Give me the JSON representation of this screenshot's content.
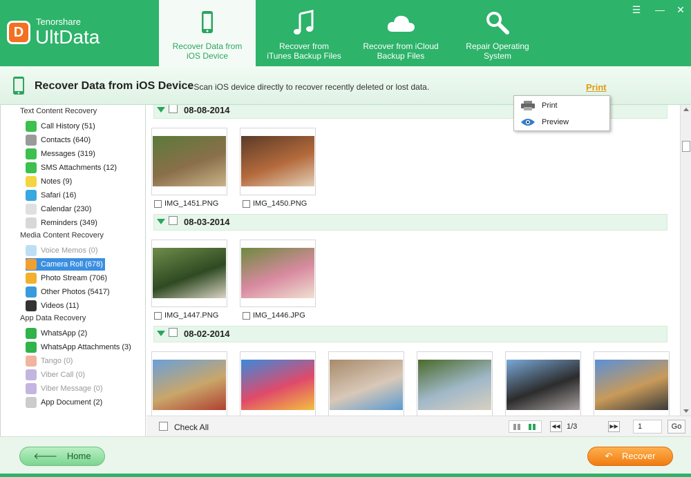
{
  "app": {
    "company": "Tenorshare",
    "product": "UltData",
    "logo_letter": "D",
    "accent_color": "#2db36a",
    "orange_color": "#f37021"
  },
  "tabs": [
    {
      "line1": "Recover Data from",
      "line2": "iOS Device",
      "icon": "phone-icon",
      "active": true
    },
    {
      "line1": "Recover from",
      "line2": "iTunes Backup Files",
      "icon": "music-note-icon",
      "active": false
    },
    {
      "line1": "Recover from iCloud",
      "line2": "Backup Files",
      "icon": "cloud-icon",
      "active": false
    },
    {
      "line1": "Repair Operating",
      "line2": "System",
      "icon": "wrench-icon",
      "active": false
    }
  ],
  "window_controls": {
    "menu": "☰",
    "minimize": "—",
    "close": "✕"
  },
  "subheader": {
    "title": "Recover Data from iOS Device",
    "description": "- Scan iOS device directly to recover recently deleted or lost data.",
    "print_link": "Print"
  },
  "print_menu": {
    "items": [
      {
        "label": "Print",
        "icon": "printer-icon"
      },
      {
        "label": "Preview",
        "icon": "eye-icon"
      }
    ]
  },
  "sidebar": {
    "categories": [
      {
        "title": "Text Content Recovery",
        "items": [
          {
            "label": "Call History (51)",
            "icon": "phone-icon",
            "color": "#3cc04e",
            "disabled": false
          },
          {
            "label": "Contacts (640)",
            "icon": "contacts-icon",
            "color": "#9a9a9a",
            "disabled": false
          },
          {
            "label": "Messages (319)",
            "icon": "messages-icon",
            "color": "#3cc04e",
            "disabled": false
          },
          {
            "label": "SMS Attachments (12)",
            "icon": "paperclip-icon",
            "color": "#3cc04e",
            "disabled": false
          },
          {
            "label": "Notes (9)",
            "icon": "notes-icon",
            "color": "#f5d442",
            "disabled": false
          },
          {
            "label": "Safari (16)",
            "icon": "safari-icon",
            "color": "#37a8e0",
            "disabled": false
          },
          {
            "label": "Calendar (230)",
            "icon": "calendar-icon",
            "color": "#e0e0e0",
            "disabled": false
          },
          {
            "label": "Reminders (349)",
            "icon": "reminders-icon",
            "color": "#d8d8d8",
            "disabled": false
          }
        ]
      },
      {
        "title": "Media Content Recovery",
        "items": [
          {
            "label": "Voice Memos (0)",
            "icon": "voice-memo-icon",
            "color": "#6ab8e8",
            "disabled": true
          },
          {
            "label": "Camera Roll (678)",
            "icon": "camera-roll-icon",
            "color": "#f0a030",
            "disabled": false,
            "selected": true
          },
          {
            "label": "Photo Stream (706)",
            "icon": "photo-stream-icon",
            "color": "#f2b02e",
            "disabled": false
          },
          {
            "label": "Other Photos (5417)",
            "icon": "other-photos-icon",
            "color": "#3a9bdc",
            "disabled": false
          },
          {
            "label": "Videos (11)",
            "icon": "video-icon",
            "color": "#333333",
            "disabled": false
          }
        ]
      },
      {
        "title": "App Data Recovery",
        "items": [
          {
            "label": "WhatsApp (2)",
            "icon": "whatsapp-icon",
            "color": "#2fb34a",
            "disabled": false
          },
          {
            "label": "WhatsApp Attachments (3)",
            "icon": "paperclip-icon",
            "color": "#2fb34a",
            "disabled": false
          },
          {
            "label": "Tango (0)",
            "icon": "tango-icon",
            "color": "#e05a2a",
            "disabled": true
          },
          {
            "label": "Viber Call (0)",
            "icon": "viber-icon",
            "color": "#7b5cb8",
            "disabled": true
          },
          {
            "label": "Viber Message (0)",
            "icon": "viber-icon",
            "color": "#7b5cb8",
            "disabled": true
          },
          {
            "label": "App Document (2)",
            "icon": "document-icon",
            "color": "#cccccc",
            "disabled": false
          }
        ]
      }
    ]
  },
  "groups": [
    {
      "date": "08-08-2014",
      "photos": [
        {
          "name": "IMG_1451.PNG",
          "colors": [
            "#5b7a3a",
            "#8a6f4a",
            "#c9b38a"
          ]
        },
        {
          "name": "IMG_1450.PNG",
          "colors": [
            "#5a3b28",
            "#b46a3c",
            "#e2d0b8"
          ]
        }
      ]
    },
    {
      "date": "08-03-2014",
      "photos": [
        {
          "name": "IMG_1447.PNG",
          "colors": [
            "#6f8c4b",
            "#2f4a22",
            "#d9d3c4"
          ]
        },
        {
          "name": "IMG_1446.JPG",
          "colors": [
            "#6d8a3e",
            "#d88aa0",
            "#f0e0d0"
          ]
        }
      ]
    },
    {
      "date": "08-02-2014",
      "photos": [
        {
          "name": "",
          "colors": [
            "#6aa0d8",
            "#c9a66a",
            "#b04030"
          ]
        },
        {
          "name": "",
          "colors": [
            "#3a8adc",
            "#e04a6a",
            "#f3c040"
          ]
        },
        {
          "name": "",
          "colors": [
            "#a88a6a",
            "#d8c8b8",
            "#5a9ad0"
          ]
        },
        {
          "name": "",
          "colors": [
            "#4a6a2a",
            "#a0b8c8",
            "#d8d0c0"
          ]
        },
        {
          "name": "",
          "colors": [
            "#7aa8d8",
            "#2c2c2c",
            "#a8a0a0"
          ]
        },
        {
          "name": "",
          "colors": [
            "#5a90d8",
            "#c89a5a",
            "#3a3a3a"
          ]
        }
      ]
    }
  ],
  "footer": {
    "check_all": "Check All",
    "page_count": "1/3",
    "page_input": "1",
    "go": "Go",
    "first": "◀◀",
    "last": "▶▶"
  },
  "bottom": {
    "home": "Home",
    "recover": "Recover"
  }
}
